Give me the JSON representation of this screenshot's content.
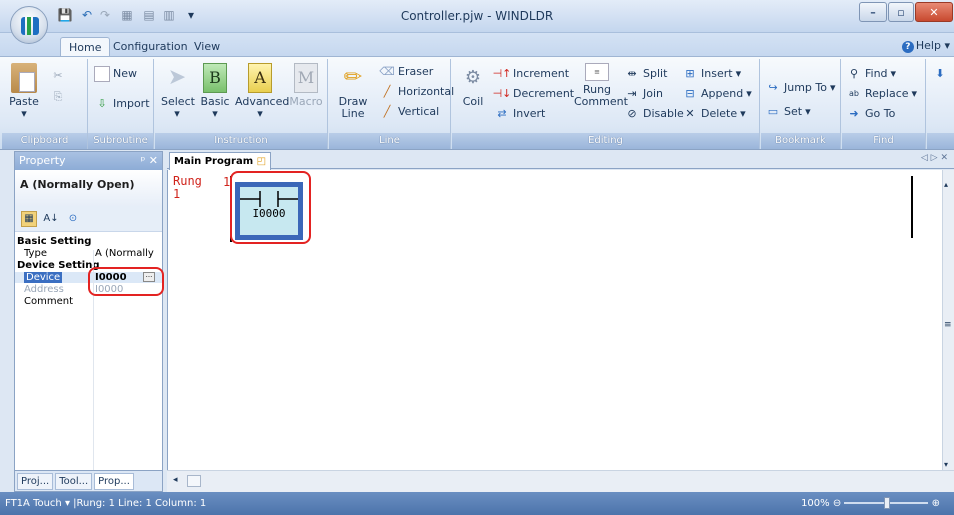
{
  "window": {
    "title": "Controller.pjw - WINDLDR"
  },
  "ribbon_tabs": [
    "Home",
    "Configuration",
    "View"
  ],
  "help_label": "Help",
  "ribbon": {
    "clipboard": {
      "label": "Clipboard",
      "paste": "Paste"
    },
    "subroutine": {
      "label": "Subroutine",
      "new": "New",
      "import": "Import"
    },
    "instruction": {
      "label": "Instruction",
      "select": "Select",
      "basic": "Basic",
      "advanced": "Advanced",
      "macro": "Macro"
    },
    "line": {
      "label": "Line",
      "draw": "Draw",
      "draw2": "Line",
      "eraser": "Eraser",
      "horizontal": "Horizontal",
      "vertical": "Vertical"
    },
    "editing": {
      "label": "Editing",
      "coil": "Coil",
      "increment": "Increment",
      "decrement": "Decrement",
      "invert": "Invert",
      "rung": "Rung",
      "comment": "Comment",
      "split": "Split",
      "join": "Join",
      "disable": "Disable",
      "insert": "Insert",
      "append": "Append",
      "delete": "Delete"
    },
    "bookmark": {
      "label": "Bookmark",
      "jump": "Jump To",
      "set": "Set"
    },
    "find": {
      "label": "Find",
      "find": "Find",
      "replace": "Replace",
      "goto": "Go To"
    }
  },
  "property": {
    "header": "Property",
    "title": "A (Normally Open)",
    "rows": {
      "basic": "Basic Setting",
      "type_key": "Type",
      "type_val": "A (Normally",
      "device_sec": "Device Setting",
      "device_key": "Device",
      "device_val": "I0000",
      "address_key": "Address",
      "address_val": "I0000",
      "comment_key": "Comment"
    }
  },
  "bottom_tabs": [
    "Proj...",
    "Tool...",
    "Prop..."
  ],
  "doc_tab": "Main Program",
  "editor": {
    "rung_label": "Rung",
    "rung_sub": "1",
    "rung_num": "1",
    "contact_device": "I0000"
  },
  "status": {
    "text": "FT1A Touch ▾  |Rung: 1  Line: 1  Column: 1",
    "zoom": "100%"
  },
  "colors": {
    "highlight": "#e32322",
    "contact_fill": "#c7e8f0",
    "contact_border": "#3b67b8",
    "rung_text": "#d0241c"
  }
}
